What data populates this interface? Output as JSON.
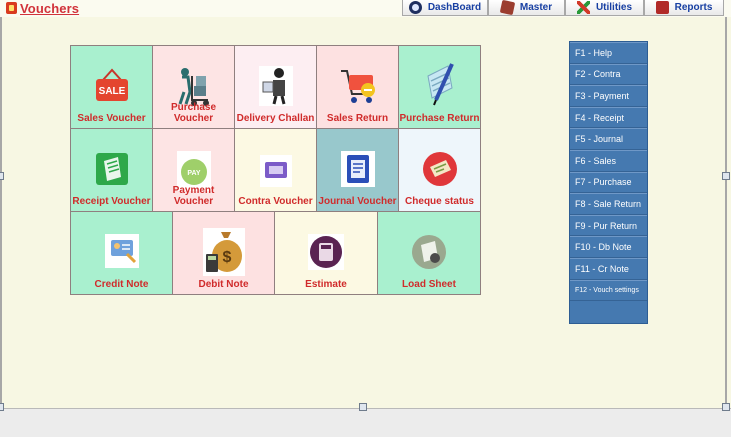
{
  "window": {
    "title": "Vouchers"
  },
  "nav_tabs": [
    {
      "label": "DashBoard",
      "icon": "dashboard-icon"
    },
    {
      "label": "Master",
      "icon": "master-icon"
    },
    {
      "label": "Utilities",
      "icon": "utilities-icon"
    },
    {
      "label": "Reports",
      "icon": "reports-icon"
    }
  ],
  "tiles": [
    {
      "label": "Sales Voucher",
      "icon": "sale-basket-icon",
      "bg": "#a9f0cf"
    },
    {
      "label": "Purchase Voucher",
      "icon": "hand-truck-icon",
      "bg": "#fde4e4"
    },
    {
      "label": "Delivery Challan",
      "icon": "delivery-person-icon",
      "bg": "#fdeef2"
    },
    {
      "label": "Sales Return",
      "icon": "shopping-cart-icon",
      "bg": "#fde1e1"
    },
    {
      "label": "Purchase Return",
      "icon": "receipt-pen-icon",
      "bg": "#a9f0cf"
    },
    {
      "label": "Receipt Voucher",
      "icon": "receipt-icon",
      "bg": "#a9f0cf"
    },
    {
      "label": "Payment Voucher",
      "icon": "pay-coin-icon",
      "bg": "#fde4e4"
    },
    {
      "label": "Contra Voucher",
      "icon": "contra-card-icon",
      "bg": "#fcf9e3"
    },
    {
      "label": "Journal Voucher",
      "icon": "journal-doc-icon",
      "bg": "#98c8cc"
    },
    {
      "label": "Cheque status",
      "icon": "cheque-icon",
      "bg": "#eef6fb"
    },
    {
      "label": "Credit Note",
      "icon": "credit-card-doc-icon",
      "bg": "#a9f0cf"
    },
    {
      "label": "Debit Note",
      "icon": "money-bag-calculator-icon",
      "bg": "#fde1e1"
    },
    {
      "label": "Estimate",
      "icon": "calculator-icon",
      "bg": "#fcf9e3"
    },
    {
      "label": "Load Sheet",
      "icon": "load-sheet-icon",
      "bg": "#a9f0cf"
    }
  ],
  "shortcuts": [
    "F1 - Help",
    "F2 - Contra",
    "F3 - Payment",
    "F4 - Receipt",
    "F5 - Journal",
    "F6 - Sales",
    "F7 - Purchase",
    "F8 - Sale Return",
    "F9 - Pur Return",
    "F10 - Db Note",
    "F11 - Cr Note",
    "F12 - Vouch settings"
  ],
  "colors": {
    "accent_red": "#d02b2b",
    "nav_blue": "#173fa3",
    "sidebar_blue": "#4579b0",
    "background": "#f7f7e3"
  },
  "icon_text": {
    "sale": "SALE",
    "pay": "PAY"
  }
}
